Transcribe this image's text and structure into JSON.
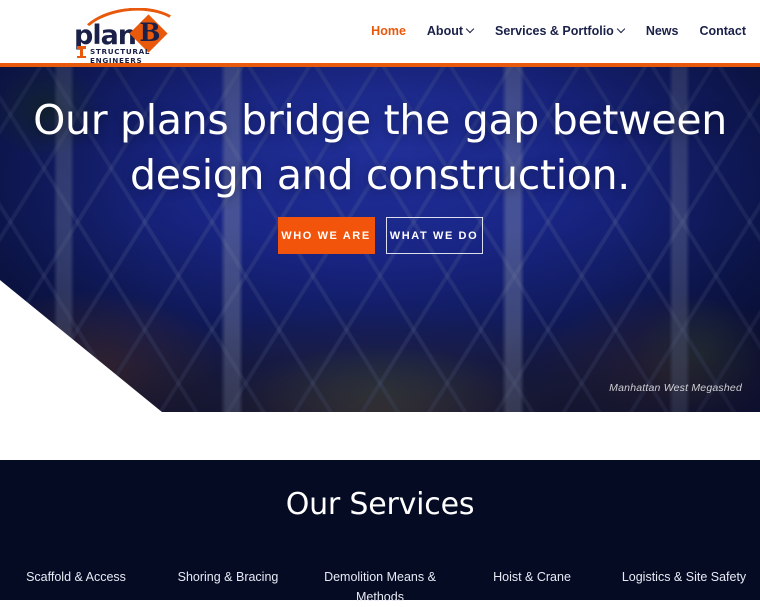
{
  "colors": {
    "brand_orange": "#E8590C",
    "button_orange": "#F2540B",
    "navy": "#1A2048",
    "dark_section": "#060B24",
    "white": "#FFFFFF"
  },
  "header": {
    "logo": {
      "wordmark": "plan",
      "mark_letter": "B",
      "tagline": "STRUCTURAL ENGINEERS",
      "arc_icon": "arc-swoosh-icon",
      "column_icon": "column-icon"
    },
    "nav": [
      {
        "label": "Home",
        "active": true,
        "has_dropdown": false
      },
      {
        "label": "About",
        "active": false,
        "has_dropdown": true
      },
      {
        "label": "Services & Portfolio",
        "active": false,
        "has_dropdown": true
      },
      {
        "label": "News",
        "active": false,
        "has_dropdown": false
      },
      {
        "label": "Contact",
        "active": false,
        "has_dropdown": false
      }
    ]
  },
  "hero": {
    "title_line1": "Our plans bridge the gap between",
    "title_line2": "design and construction.",
    "buttons": [
      {
        "label": "WHO WE ARE",
        "style": "solid"
      },
      {
        "label": "WHAT WE DO",
        "style": "outline"
      }
    ],
    "image_caption": "Manhattan West Megashed"
  },
  "services": {
    "title": "Our Services",
    "items": [
      {
        "label": "Scaffold & Access"
      },
      {
        "label": "Shoring & Bracing"
      },
      {
        "label": "Demolition Means & Methods"
      },
      {
        "label": "Hoist & Crane"
      },
      {
        "label": "Logistics & Site Safety"
      }
    ]
  }
}
